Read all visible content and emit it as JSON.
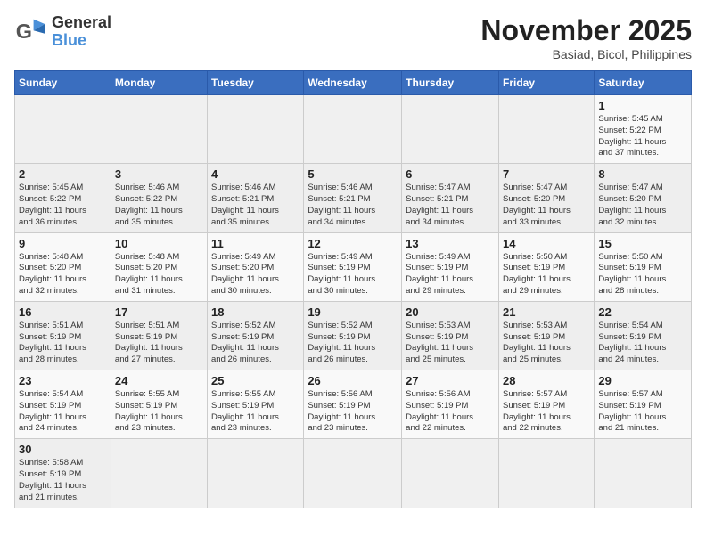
{
  "header": {
    "logo_general": "General",
    "logo_blue": "Blue",
    "month_title": "November 2025",
    "location": "Basiad, Bicol, Philippines"
  },
  "weekdays": [
    "Sunday",
    "Monday",
    "Tuesday",
    "Wednesday",
    "Thursday",
    "Friday",
    "Saturday"
  ],
  "weeks": [
    [
      {
        "day": "",
        "info": ""
      },
      {
        "day": "",
        "info": ""
      },
      {
        "day": "",
        "info": ""
      },
      {
        "day": "",
        "info": ""
      },
      {
        "day": "",
        "info": ""
      },
      {
        "day": "",
        "info": ""
      },
      {
        "day": "1",
        "info": "Sunrise: 5:45 AM\nSunset: 5:22 PM\nDaylight: 11 hours\nand 37 minutes."
      }
    ],
    [
      {
        "day": "2",
        "info": "Sunrise: 5:45 AM\nSunset: 5:22 PM\nDaylight: 11 hours\nand 36 minutes."
      },
      {
        "day": "3",
        "info": "Sunrise: 5:46 AM\nSunset: 5:22 PM\nDaylight: 11 hours\nand 35 minutes."
      },
      {
        "day": "4",
        "info": "Sunrise: 5:46 AM\nSunset: 5:21 PM\nDaylight: 11 hours\nand 35 minutes."
      },
      {
        "day": "5",
        "info": "Sunrise: 5:46 AM\nSunset: 5:21 PM\nDaylight: 11 hours\nand 34 minutes."
      },
      {
        "day": "6",
        "info": "Sunrise: 5:47 AM\nSunset: 5:21 PM\nDaylight: 11 hours\nand 34 minutes."
      },
      {
        "day": "7",
        "info": "Sunrise: 5:47 AM\nSunset: 5:20 PM\nDaylight: 11 hours\nand 33 minutes."
      },
      {
        "day": "8",
        "info": "Sunrise: 5:47 AM\nSunset: 5:20 PM\nDaylight: 11 hours\nand 32 minutes."
      }
    ],
    [
      {
        "day": "9",
        "info": "Sunrise: 5:48 AM\nSunset: 5:20 PM\nDaylight: 11 hours\nand 32 minutes."
      },
      {
        "day": "10",
        "info": "Sunrise: 5:48 AM\nSunset: 5:20 PM\nDaylight: 11 hours\nand 31 minutes."
      },
      {
        "day": "11",
        "info": "Sunrise: 5:49 AM\nSunset: 5:20 PM\nDaylight: 11 hours\nand 30 minutes."
      },
      {
        "day": "12",
        "info": "Sunrise: 5:49 AM\nSunset: 5:19 PM\nDaylight: 11 hours\nand 30 minutes."
      },
      {
        "day": "13",
        "info": "Sunrise: 5:49 AM\nSunset: 5:19 PM\nDaylight: 11 hours\nand 29 minutes."
      },
      {
        "day": "14",
        "info": "Sunrise: 5:50 AM\nSunset: 5:19 PM\nDaylight: 11 hours\nand 29 minutes."
      },
      {
        "day": "15",
        "info": "Sunrise: 5:50 AM\nSunset: 5:19 PM\nDaylight: 11 hours\nand 28 minutes."
      }
    ],
    [
      {
        "day": "16",
        "info": "Sunrise: 5:51 AM\nSunset: 5:19 PM\nDaylight: 11 hours\nand 28 minutes."
      },
      {
        "day": "17",
        "info": "Sunrise: 5:51 AM\nSunset: 5:19 PM\nDaylight: 11 hours\nand 27 minutes."
      },
      {
        "day": "18",
        "info": "Sunrise: 5:52 AM\nSunset: 5:19 PM\nDaylight: 11 hours\nand 26 minutes."
      },
      {
        "day": "19",
        "info": "Sunrise: 5:52 AM\nSunset: 5:19 PM\nDaylight: 11 hours\nand 26 minutes."
      },
      {
        "day": "20",
        "info": "Sunrise: 5:53 AM\nSunset: 5:19 PM\nDaylight: 11 hours\nand 25 minutes."
      },
      {
        "day": "21",
        "info": "Sunrise: 5:53 AM\nSunset: 5:19 PM\nDaylight: 11 hours\nand 25 minutes."
      },
      {
        "day": "22",
        "info": "Sunrise: 5:54 AM\nSunset: 5:19 PM\nDaylight: 11 hours\nand 24 minutes."
      }
    ],
    [
      {
        "day": "23",
        "info": "Sunrise: 5:54 AM\nSunset: 5:19 PM\nDaylight: 11 hours\nand 24 minutes."
      },
      {
        "day": "24",
        "info": "Sunrise: 5:55 AM\nSunset: 5:19 PM\nDaylight: 11 hours\nand 23 minutes."
      },
      {
        "day": "25",
        "info": "Sunrise: 5:55 AM\nSunset: 5:19 PM\nDaylight: 11 hours\nand 23 minutes."
      },
      {
        "day": "26",
        "info": "Sunrise: 5:56 AM\nSunset: 5:19 PM\nDaylight: 11 hours\nand 23 minutes."
      },
      {
        "day": "27",
        "info": "Sunrise: 5:56 AM\nSunset: 5:19 PM\nDaylight: 11 hours\nand 22 minutes."
      },
      {
        "day": "28",
        "info": "Sunrise: 5:57 AM\nSunset: 5:19 PM\nDaylight: 11 hours\nand 22 minutes."
      },
      {
        "day": "29",
        "info": "Sunrise: 5:57 AM\nSunset: 5:19 PM\nDaylight: 11 hours\nand 21 minutes."
      }
    ],
    [
      {
        "day": "30",
        "info": "Sunrise: 5:58 AM\nSunset: 5:19 PM\nDaylight: 11 hours\nand 21 minutes."
      },
      {
        "day": "",
        "info": ""
      },
      {
        "day": "",
        "info": ""
      },
      {
        "day": "",
        "info": ""
      },
      {
        "day": "",
        "info": ""
      },
      {
        "day": "",
        "info": ""
      },
      {
        "day": "",
        "info": ""
      }
    ]
  ]
}
